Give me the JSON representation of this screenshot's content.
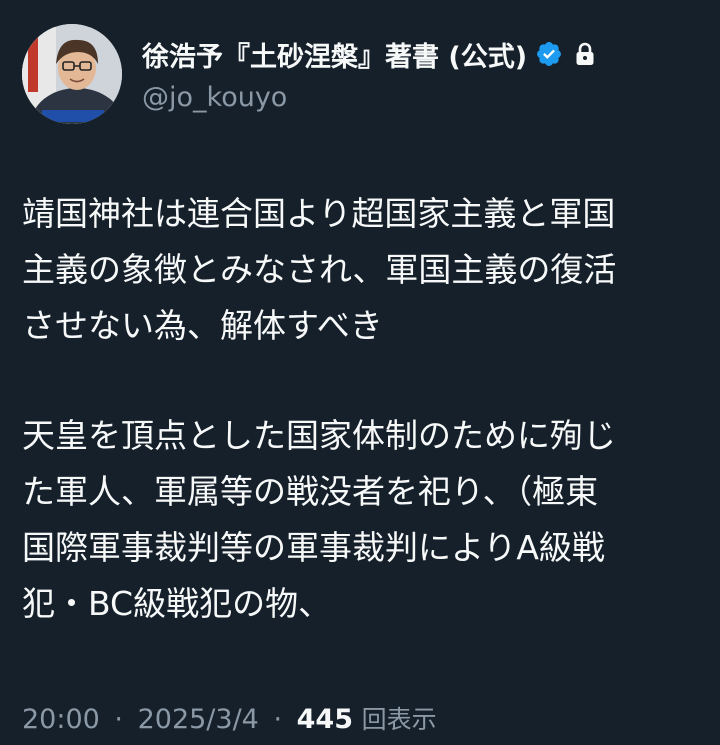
{
  "author": {
    "display_name": "徐浩予『土砂涅槃』著書 (公式)",
    "handle": "@jo_kouyo",
    "verified_color": "#1d9bf0",
    "avatar_icon": "profile-photo",
    "badges": [
      "verified-badge-icon",
      "lock-icon"
    ]
  },
  "body": {
    "paragraph1": [
      "靖国神社は連合国より超国家主義と軍国",
      "主義の象徴とみなされ、軍国主義の復活",
      "させない為、解体すべき"
    ],
    "paragraph2": [
      "天皇を頂点とした国家体制のために殉じ",
      "た軍人、軍属等の戦没者を祀り、（極東",
      "国際軍事裁判等の軍事裁判によりA級戦",
      "犯・BC級戦犯の物、"
    ]
  },
  "meta": {
    "time": "20:00",
    "separator": "·",
    "date": "2025/3/4",
    "views_count": "445",
    "views_label": "回表示"
  },
  "colors": {
    "background": "#15202b",
    "text_primary": "#f7f9f9",
    "text_secondary": "#8b98a5"
  }
}
